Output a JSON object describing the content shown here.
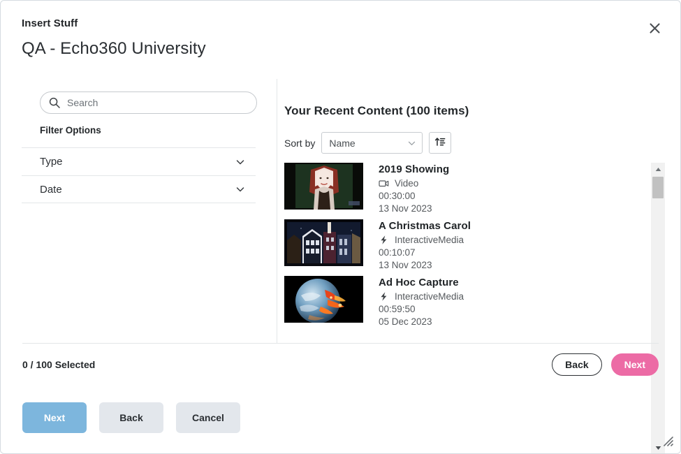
{
  "dialog": {
    "eyebrow": "Insert Stuff",
    "title": "QA - Echo360 University",
    "close_icon": "close-icon",
    "resize_icon": "resize-grip-icon",
    "accent_pink": "#ec6ba5",
    "accent_blue": "#7db6dd",
    "border_color": "#d5dbe0"
  },
  "sidebar": {
    "search": {
      "placeholder": "Search",
      "value": "",
      "icon": "search-icon"
    },
    "filter_options_label": "Filter Options",
    "filters": [
      {
        "label": "Type",
        "icon": "chevron-down-icon",
        "expanded": false
      },
      {
        "label": "Date",
        "icon": "chevron-down-icon",
        "expanded": false
      }
    ]
  },
  "content": {
    "heading": "Your Recent Content (100 items)",
    "sort": {
      "label": "Sort by",
      "selected": "Name",
      "options": [
        "Name"
      ],
      "select_icon": "chevron-down-icon",
      "direction_icon": "sort-ascending-icon"
    },
    "items": [
      {
        "title": "2019 Showing",
        "type": "Video",
        "type_icon": "video-camera-icon",
        "duration": "00:30:00",
        "date": "13 Nov 2023",
        "thumbnail": "portrait-renaissance-woman"
      },
      {
        "title": "A Christmas Carol",
        "type": "InteractiveMedia",
        "type_icon": "lightning-bolt-icon",
        "duration": "00:10:07",
        "date": "13 Nov 2023",
        "thumbnail": "victorian-night-street"
      },
      {
        "title": "Ad Hoc Capture",
        "type": "InteractiveMedia",
        "type_icon": "lightning-bolt-icon",
        "duration": "00:59:50",
        "date": "05 Dec 2023",
        "thumbnail": "earth-from-space-fires"
      }
    ],
    "scrollbar": {
      "up_icon": "scroll-up-arrow-icon",
      "down_icon": "scroll-down-arrow-icon"
    }
  },
  "selection": {
    "count_text": "0 / 100 Selected",
    "back_label": "Back",
    "next_label": "Next"
  },
  "bottom_bar": {
    "next_label": "Next",
    "back_label": "Back",
    "cancel_label": "Cancel"
  }
}
